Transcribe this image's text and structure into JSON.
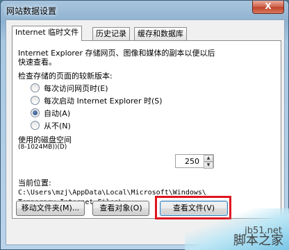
{
  "window": {
    "title": "网站数据设置",
    "close_glyph": "X"
  },
  "tabs": [
    {
      "label": "Internet 临时文件",
      "active": true
    },
    {
      "label": "历史记录",
      "active": false
    },
    {
      "label": "缓存和数据库",
      "active": false
    }
  ],
  "panel": {
    "description_line1": "Internet Explorer 存储网页、图像和媒体的副本以便以后",
    "description_line2": "快速查看。",
    "check_label": "检查存储的页面的较新版本:",
    "options": [
      {
        "label": "每次访问网页时(E)",
        "selected": false
      },
      {
        "label": "每次启动 Internet Explorer 时(S)",
        "selected": false
      },
      {
        "label": "自动(A)",
        "selected": true
      },
      {
        "label": "从不(N)",
        "selected": false
      }
    ],
    "disk_label_line1": "使用的磁盘空间",
    "disk_label_line2": "(8-1024MB))(D)",
    "disk_value": "250",
    "location_label": "当前位置:",
    "location_line1": "C:\\Users\\mzj\\AppData\\Local\\Microsoft\\Windows\\",
    "location_line2": "Temporary Internet Files\\"
  },
  "buttons": {
    "move_folder": "移动文件夹(M)...",
    "view_objects": "查看对象(O)",
    "view_files": "查看文件(V)"
  },
  "watermark": {
    "url": "jb51.net",
    "name": "脚本之家"
  },
  "colors": {
    "highlight": "#e0141e",
    "accent": "#3c7fb1"
  }
}
